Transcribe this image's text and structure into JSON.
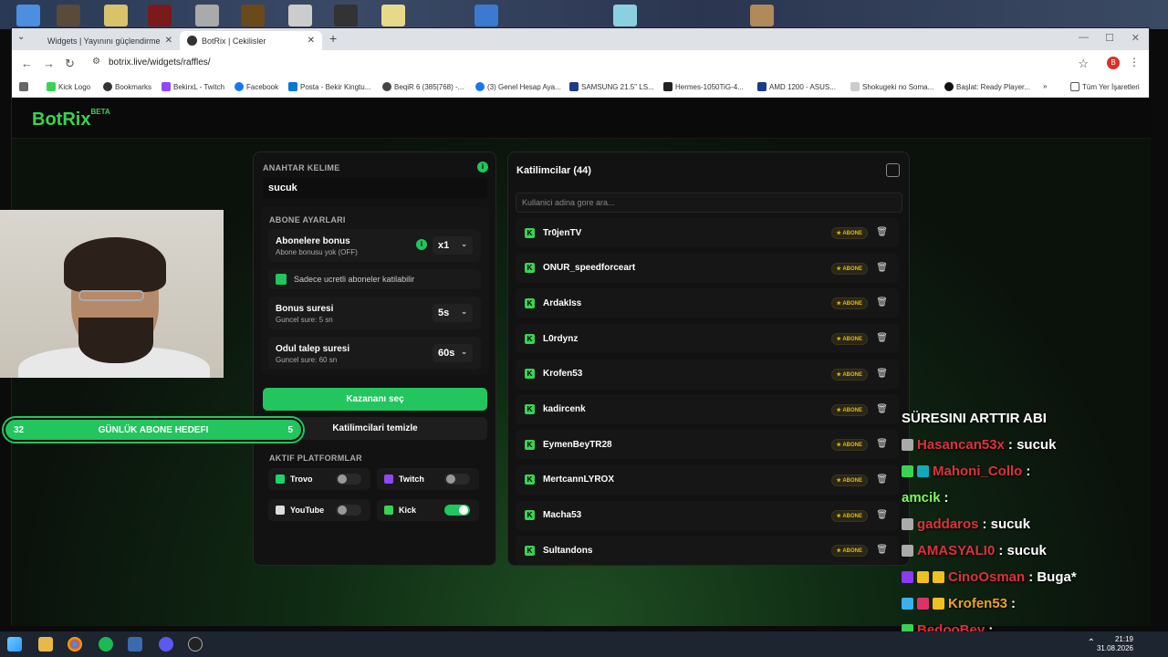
{
  "browser": {
    "tabs": [
      {
        "label": "Widgets | Yayınını güçlendirme"
      },
      {
        "label": "BotRix | Cekilisler"
      }
    ],
    "url": "botrix.live/widgets/raffles/",
    "bookmarks": [
      "Kick Logo",
      "Bookmarks",
      "BekirxL - Twitch",
      "Facebook",
      "Posta - Bekir Kingtu...",
      "BeqiR 6 (385|768) -...",
      "(3) Genel Hesap Aya...",
      "SAMSUNG 21.5\" LS...",
      "Hermes-1050TiG-4...",
      "AMD 1200 - ASUS...",
      "Shokugeki no Soma...",
      "Başlat: Ready Player...",
      "Tüm Yer İşaretleri"
    ]
  },
  "app": {
    "logo": "BotRix",
    "logo_beta": "BETA"
  },
  "raffle": {
    "keyword_label": "ANAHTAR KELIME",
    "keyword_value": "sucuk",
    "sub_settings_label": "ABONE AYARLARI",
    "sub_bonus_title": "Abonelere bonus",
    "sub_bonus_sub": "Abone bonusu yok (OFF)",
    "sub_bonus_value": "x1",
    "paid_only": "Sadece ucretli aboneler katilabilir",
    "bonus_time_title": "Bonus suresi",
    "bonus_time_sub": "Guncel sure: 5 sn",
    "bonus_time_value": "5s",
    "claim_time_title": "Odul talep suresi",
    "claim_time_sub": "Guncel sure: 60 sn",
    "claim_time_value": "60s",
    "pick_winner": "Kazananı seç",
    "clear_participants": "Katilimcilari temizle",
    "platforms_label": "AKTIF PLATFORMLAR",
    "platforms": [
      {
        "name": "Trovo",
        "enabled": false
      },
      {
        "name": "Twitch",
        "enabled": false
      },
      {
        "name": "YouTube",
        "enabled": false
      },
      {
        "name": "Kick",
        "enabled": true
      }
    ]
  },
  "participants": {
    "title": "Katilimcilar (44)",
    "search_placeholder": "Kullanici adina gore ara...",
    "badge": "ABONE",
    "list": [
      "Tr0jenTV",
      "ONUR_speedforceart",
      "ArdakIss",
      "L0rdynz",
      "Krofen53",
      "kadircenk",
      "EymenBeyTR28",
      "MertcannLYROX",
      "Macha53",
      "Sultandons"
    ]
  },
  "goal": {
    "left": "32",
    "text": "GÜNLÜK ABONE HEDEFI",
    "right": "5"
  },
  "chat": {
    "lines": [
      {
        "user": "",
        "msg": "SÜRESINI ARTTIR ABI",
        "color": "#ffffff"
      },
      {
        "user": "Hasancan53x",
        "msg": ": sucuk",
        "color": "#e0303a"
      },
      {
        "user": "Mahoni_Collo",
        "msg": ":",
        "color": "#e0303a"
      },
      {
        "user": "amcik",
        "msg": ":",
        "color": "#7cfc5a"
      },
      {
        "user": "gaddaros",
        "msg": ": sucuk",
        "color": "#e0303a"
      },
      {
        "user": "AMASYALI0",
        "msg": ": sucuk",
        "color": "#e0303a"
      },
      {
        "user": "CinoOsman",
        "msg": ": Buga*",
        "color": "#e0303a"
      },
      {
        "user": "Krofen53",
        "msg": ":",
        "color": "#f0a020"
      },
      {
        "user": "BedooBey",
        "msg": ":",
        "color": "#e0303a"
      }
    ]
  },
  "clock": {
    "time": "21:19",
    "date": "31.08.2026"
  }
}
